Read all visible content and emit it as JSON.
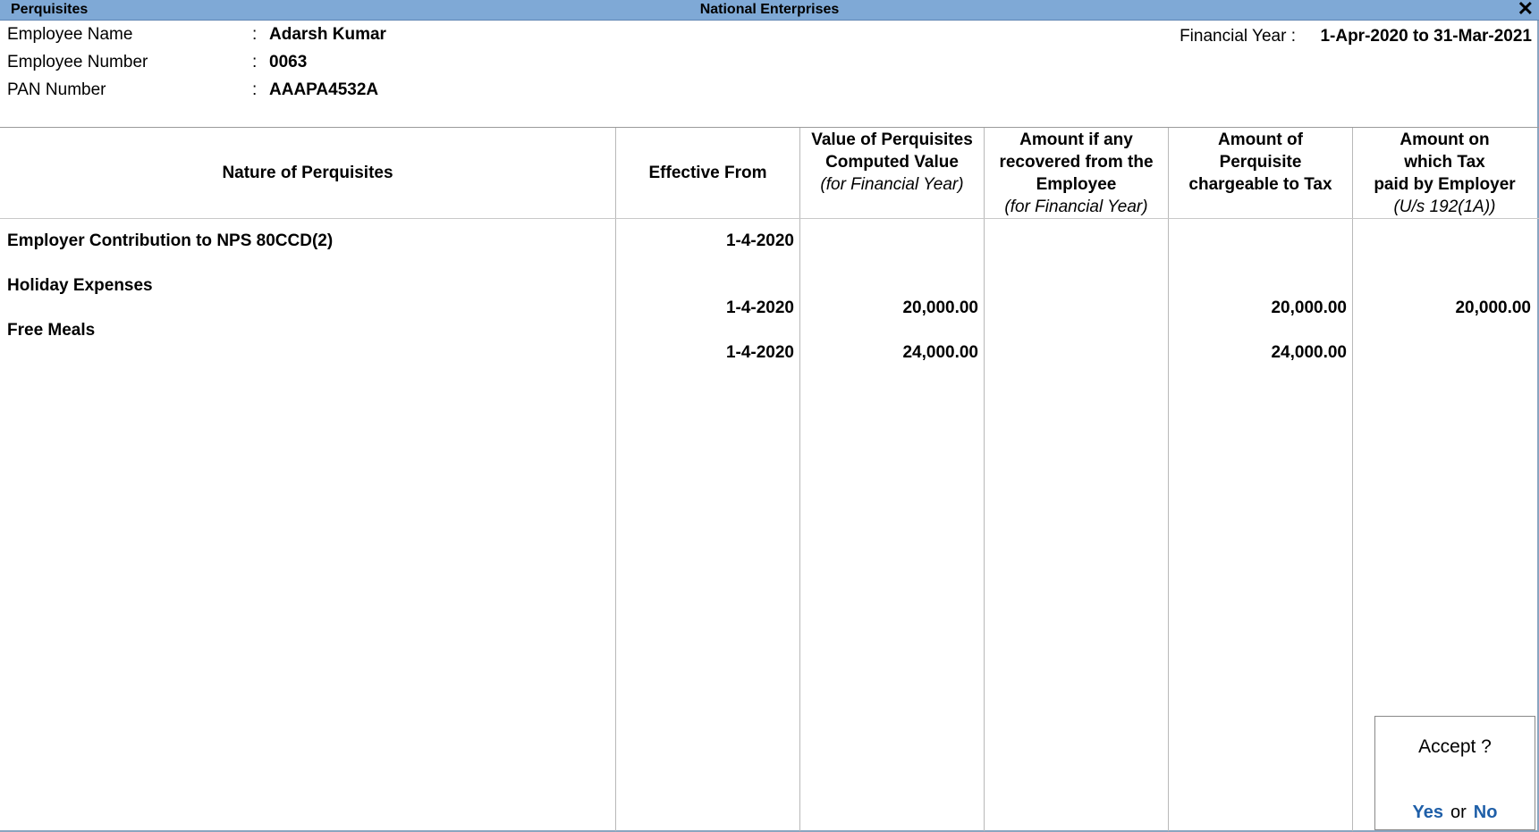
{
  "titlebar": {
    "left": "Perquisites",
    "center": "National Enterprises",
    "close_glyph": "✕"
  },
  "employee": {
    "name_label": "Employee Name",
    "name_value": "Adarsh Kumar",
    "number_label": "Employee Number",
    "number_value": "0063",
    "pan_label": "PAN Number",
    "pan_value": "AAAPA4532A",
    "colon": ":"
  },
  "financial_year": {
    "label": "Financial Year :",
    "value": "1-Apr-2020 to 31-Mar-2021"
  },
  "table": {
    "headers": {
      "nature": "Nature of Perquisites",
      "effective": "Effective From",
      "value_l1": "Value of Perquisites",
      "value_l2": "Computed Value",
      "value_l3": "(for Financial Year)",
      "recovered_l1": "Amount if any",
      "recovered_l2": "recovered from the",
      "recovered_l3": "Employee",
      "recovered_l4": "(for Financial Year)",
      "chargeable_l1": "Amount of",
      "chargeable_l2": "Perquisite",
      "chargeable_l3": "chargeable to Tax",
      "taxpaid_l1": "Amount on",
      "taxpaid_l2": "which Tax",
      "taxpaid_l3": "paid by Employer",
      "taxpaid_l4": "(U/s 192(1A))"
    },
    "rows": [
      {
        "nature": "Employer Contribution to NPS 80CCD(2)",
        "effective": "1-4-2020",
        "value": "",
        "recovered": "",
        "chargeable": "",
        "taxpaid": ""
      },
      {
        "nature": "Holiday Expenses",
        "effective": "1-4-2020",
        "value": "20,000.00",
        "recovered": "",
        "chargeable": "20,000.00",
        "taxpaid": "20,000.00"
      },
      {
        "nature": "Free Meals",
        "effective": "1-4-2020",
        "value": "24,000.00",
        "recovered": "",
        "chargeable": "24,000.00",
        "taxpaid": ""
      }
    ]
  },
  "accept_dialog": {
    "question": "Accept ?",
    "yes": "Yes",
    "or": "or",
    "no": "No"
  }
}
